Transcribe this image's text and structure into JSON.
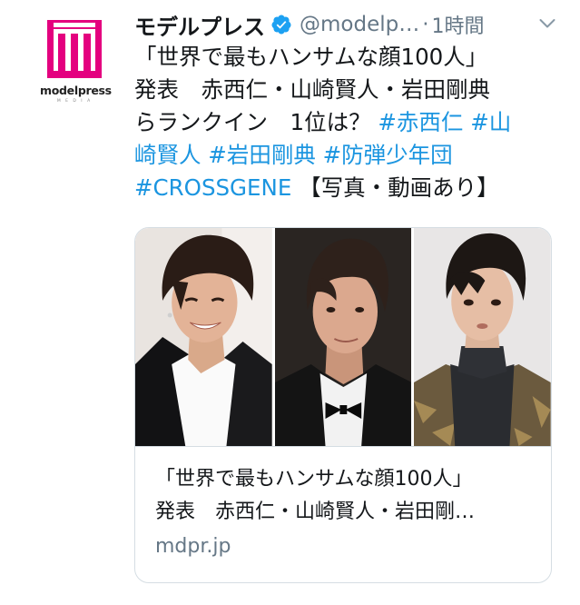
{
  "account": {
    "display_name": "モデルプレス",
    "handle": "@modelp…",
    "separator": "·",
    "timestamp": "1時間",
    "verified": true,
    "avatar_brand": "modelpress",
    "avatar_sub": "M E D I A",
    "brand_color": "#e4007f"
  },
  "tweet": {
    "lines": [
      [
        {
          "text": "「世界で最もハンサムな顔100人」",
          "type": "text"
        }
      ],
      [
        {
          "text": "発表　赤西仁・山崎賢人・岩田剛典",
          "type": "text"
        }
      ],
      [
        {
          "text": "らランクイン　1位は？ ",
          "type": "text"
        },
        {
          "text": "#赤西仁",
          "type": "hashtag"
        },
        {
          "text": " ",
          "type": "text"
        },
        {
          "text": "#山",
          "type": "hashtag"
        }
      ],
      [
        {
          "text": "崎賢人",
          "type": "hashtag"
        },
        {
          "text": " ",
          "type": "text"
        },
        {
          "text": "#岩田剛典",
          "type": "hashtag"
        },
        {
          "text": " ",
          "type": "text"
        },
        {
          "text": "#防弾少年団",
          "type": "hashtag"
        }
      ],
      [
        {
          "text": "#CROSSGENE",
          "type": "hashtag"
        },
        {
          "text": " 【写真・動画あり】",
          "type": "text"
        }
      ]
    ],
    "hashtag_color": "#1b95e0"
  },
  "card": {
    "photos": [
      "person-1",
      "person-2",
      "person-3"
    ],
    "title_line1": "「世界で最もハンサムな顔100人」",
    "title_line2": "発表　赤西仁・山崎賢人・岩田剛…",
    "domain": "mdpr.jp"
  },
  "icons": {
    "verified": "verified-badge-icon",
    "more": "chevron-down-icon"
  }
}
